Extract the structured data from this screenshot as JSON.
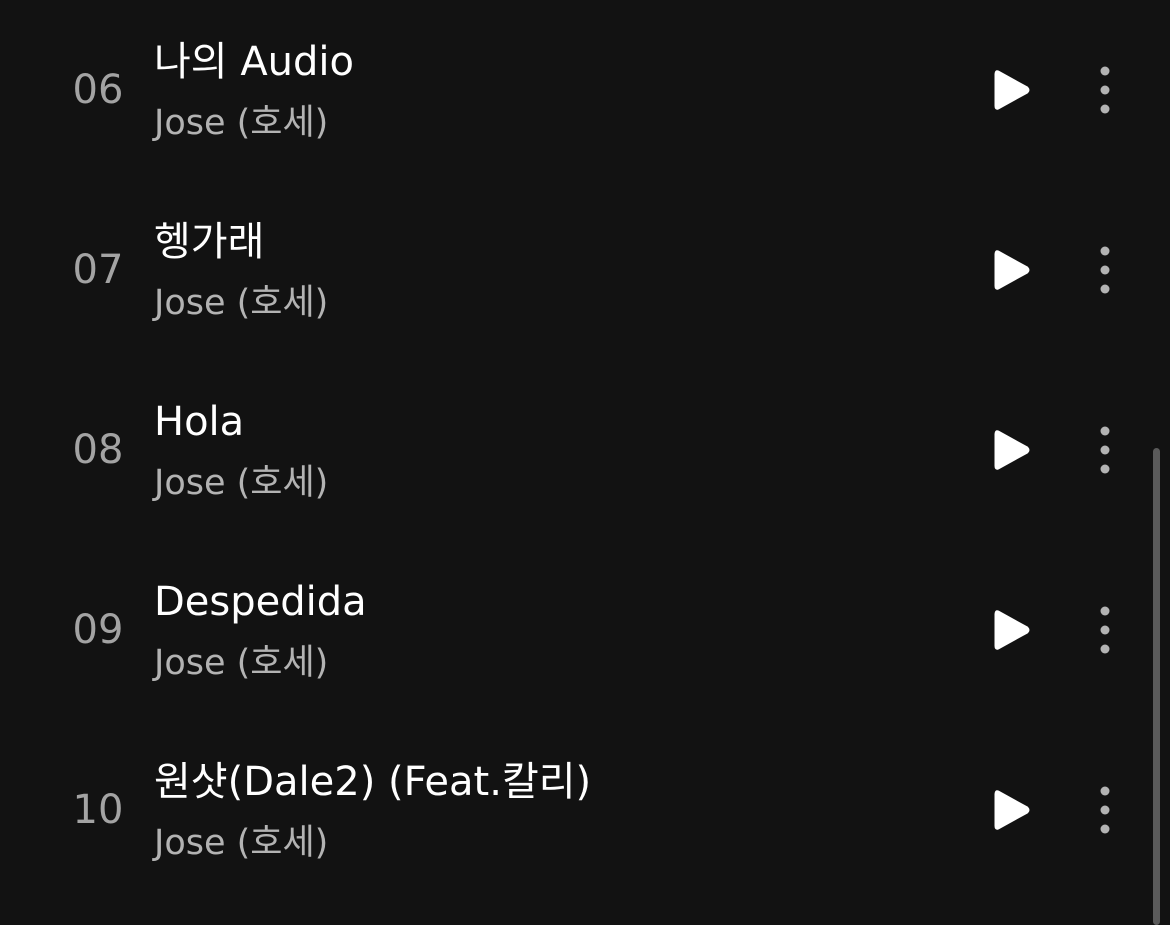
{
  "tracks": [
    {
      "number": "06",
      "title": "나의 Audio",
      "artist": "Jose (호세)"
    },
    {
      "number": "07",
      "title": "헹가래",
      "artist": "Jose (호세)"
    },
    {
      "number": "08",
      "title": "Hola",
      "artist": "Jose (호세)"
    },
    {
      "number": "09",
      "title": "Despedida",
      "artist": "Jose (호세)"
    },
    {
      "number": "10",
      "title": "원샷(Dale2) (Feat.칼리)",
      "artist": "Jose (호세)"
    }
  ],
  "icons": {
    "play": "play-icon",
    "more": "more-vertical-icon"
  },
  "colors": {
    "background": "#121212",
    "title": "#ffffff",
    "artist": "#b3b3b3",
    "number": "#a3a3a3",
    "scrollbar": "#5a5a5a"
  }
}
